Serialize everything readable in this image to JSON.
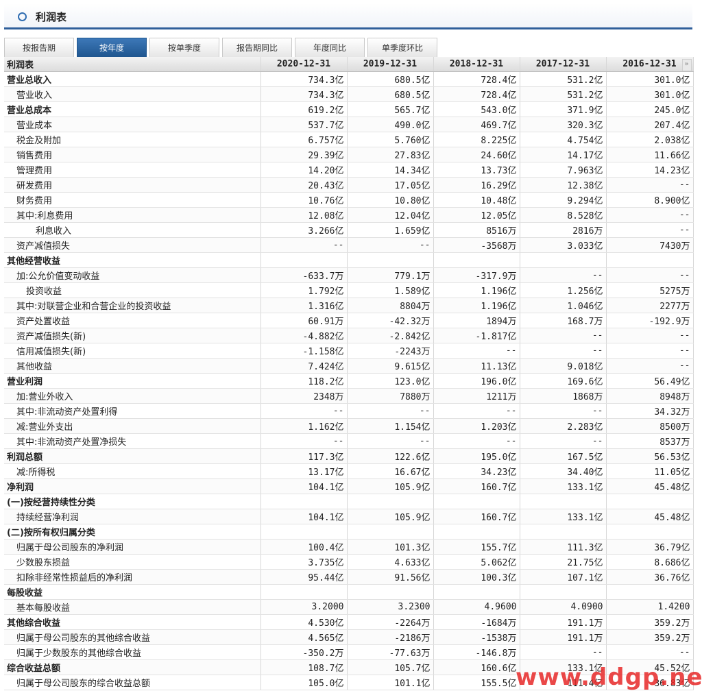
{
  "title": "利润表",
  "tabs": [
    {
      "label": "按报告期",
      "active": false
    },
    {
      "label": "按年度",
      "active": true
    },
    {
      "label": "按单季度",
      "active": false
    },
    {
      "label": "报告期同比",
      "active": false
    },
    {
      "label": "年度同比",
      "active": false
    },
    {
      "label": "单季度环比",
      "active": false
    }
  ],
  "table": {
    "corner": "利润表",
    "columns": [
      "2020-12-31",
      "2019-12-31",
      "2018-12-31",
      "2017-12-31",
      "2016-12-31"
    ],
    "scroll_glyph": "»",
    "rows": [
      {
        "label": "营业总收入",
        "header": true,
        "indent": 0,
        "values": [
          "734.3亿",
          "680.5亿",
          "728.4亿",
          "531.2亿",
          "301.0亿"
        ]
      },
      {
        "label": "营业收入",
        "header": false,
        "indent": 1,
        "values": [
          "734.3亿",
          "680.5亿",
          "728.4亿",
          "531.2亿",
          "301.0亿"
        ]
      },
      {
        "label": "营业总成本",
        "header": true,
        "indent": 0,
        "values": [
          "619.2亿",
          "565.7亿",
          "543.0亿",
          "371.9亿",
          "245.0亿"
        ]
      },
      {
        "label": "营业成本",
        "header": false,
        "indent": 1,
        "values": [
          "537.7亿",
          "490.0亿",
          "469.7亿",
          "320.3亿",
          "207.4亿"
        ]
      },
      {
        "label": "税金及附加",
        "header": false,
        "indent": 1,
        "values": [
          "6.757亿",
          "5.760亿",
          "8.225亿",
          "4.754亿",
          "2.038亿"
        ]
      },
      {
        "label": "销售费用",
        "header": false,
        "indent": 1,
        "values": [
          "29.39亿",
          "27.83亿",
          "24.60亿",
          "14.17亿",
          "11.66亿"
        ]
      },
      {
        "label": "管理费用",
        "header": false,
        "indent": 1,
        "values": [
          "14.20亿",
          "14.34亿",
          "13.73亿",
          "7.963亿",
          "14.23亿"
        ]
      },
      {
        "label": "研发费用",
        "header": false,
        "indent": 1,
        "values": [
          "20.43亿",
          "17.05亿",
          "16.29亿",
          "12.38亿",
          "--"
        ]
      },
      {
        "label": "财务费用",
        "header": false,
        "indent": 1,
        "values": [
          "10.76亿",
          "10.80亿",
          "10.48亿",
          "9.294亿",
          "8.900亿"
        ]
      },
      {
        "label": "其中:利息费用",
        "header": false,
        "indent": 1,
        "values": [
          "12.08亿",
          "12.04亿",
          "12.05亿",
          "8.528亿",
          "--"
        ]
      },
      {
        "label": "利息收入",
        "header": false,
        "indent": 3,
        "values": [
          "3.266亿",
          "1.659亿",
          "8516万",
          "2816万",
          "--"
        ]
      },
      {
        "label": "资产减值损失",
        "header": false,
        "indent": 1,
        "values": [
          "--",
          "--",
          "-3568万",
          "3.033亿",
          "7430万"
        ]
      },
      {
        "label": "其他经营收益",
        "header": true,
        "indent": 0,
        "values": [
          "",
          "",
          "",
          "",
          ""
        ]
      },
      {
        "label": "加:公允价值变动收益",
        "header": false,
        "indent": 1,
        "values": [
          "-633.7万",
          "779.1万",
          "-317.9万",
          "--",
          "--"
        ]
      },
      {
        "label": "投资收益",
        "header": false,
        "indent": 2,
        "values": [
          "1.792亿",
          "1.589亿",
          "1.196亿",
          "1.256亿",
          "5275万"
        ]
      },
      {
        "label": "其中:对联营企业和合营企业的投资收益",
        "header": false,
        "indent": 1,
        "values": [
          "1.316亿",
          "8804万",
          "1.196亿",
          "1.046亿",
          "2277万"
        ]
      },
      {
        "label": "资产处置收益",
        "header": false,
        "indent": 1,
        "values": [
          "60.91万",
          "-42.32万",
          "1894万",
          "168.7万",
          "-192.9万"
        ]
      },
      {
        "label": "资产减值损失(新)",
        "header": false,
        "indent": 1,
        "values": [
          "-4.882亿",
          "-2.842亿",
          "-1.817亿",
          "--",
          "--"
        ]
      },
      {
        "label": "信用减值损失(新)",
        "header": false,
        "indent": 1,
        "values": [
          "-1.158亿",
          "-2243万",
          "--",
          "--",
          "--"
        ]
      },
      {
        "label": "其他收益",
        "header": false,
        "indent": 1,
        "values": [
          "7.424亿",
          "9.615亿",
          "11.13亿",
          "9.018亿",
          "--"
        ]
      },
      {
        "label": "营业利润",
        "header": true,
        "indent": 0,
        "values": [
          "118.2亿",
          "123.0亿",
          "196.0亿",
          "169.6亿",
          "56.49亿"
        ]
      },
      {
        "label": "加:营业外收入",
        "header": false,
        "indent": 1,
        "values": [
          "2348万",
          "7880万",
          "1211万",
          "1868万",
          "8948万"
        ]
      },
      {
        "label": "其中:非流动资产处置利得",
        "header": false,
        "indent": 1,
        "values": [
          "--",
          "--",
          "--",
          "--",
          "34.32万"
        ]
      },
      {
        "label": "减:营业外支出",
        "header": false,
        "indent": 1,
        "values": [
          "1.162亿",
          "1.154亿",
          "1.203亿",
          "2.283亿",
          "8500万"
        ]
      },
      {
        "label": "其中:非流动资产处置净损失",
        "header": false,
        "indent": 1,
        "values": [
          "--",
          "--",
          "--",
          "--",
          "8537万"
        ]
      },
      {
        "label": "利润总额",
        "header": true,
        "indent": 0,
        "values": [
          "117.3亿",
          "122.6亿",
          "195.0亿",
          "167.5亿",
          "56.53亿"
        ]
      },
      {
        "label": "减:所得税",
        "header": false,
        "indent": 1,
        "values": [
          "13.17亿",
          "16.67亿",
          "34.23亿",
          "34.40亿",
          "11.05亿"
        ]
      },
      {
        "label": "净利润",
        "header": true,
        "indent": 0,
        "values": [
          "104.1亿",
          "105.9亿",
          "160.7亿",
          "133.1亿",
          "45.48亿"
        ]
      },
      {
        "label": "(一)按经营持续性分类",
        "header": true,
        "indent": 0,
        "values": [
          "",
          "",
          "",
          "",
          ""
        ]
      },
      {
        "label": "持续经营净利润",
        "header": false,
        "indent": 1,
        "values": [
          "104.1亿",
          "105.9亿",
          "160.7亿",
          "133.1亿",
          "45.48亿"
        ]
      },
      {
        "label": "(二)按所有权归属分类",
        "header": true,
        "indent": 0,
        "values": [
          "",
          "",
          "",
          "",
          ""
        ]
      },
      {
        "label": "归属于母公司股东的净利润",
        "header": false,
        "indent": 1,
        "values": [
          "100.4亿",
          "101.3亿",
          "155.7亿",
          "111.3亿",
          "36.79亿"
        ]
      },
      {
        "label": "少数股东损益",
        "header": false,
        "indent": 1,
        "values": [
          "3.735亿",
          "4.633亿",
          "5.062亿",
          "21.75亿",
          "8.686亿"
        ]
      },
      {
        "label": "扣除非经常性损益后的净利润",
        "header": false,
        "indent": 1,
        "values": [
          "95.44亿",
          "91.56亿",
          "100.3亿",
          "107.1亿",
          "36.76亿"
        ]
      },
      {
        "label": "每股收益",
        "header": true,
        "indent": 0,
        "values": [
          "",
          "",
          "",
          "",
          ""
        ]
      },
      {
        "label": "基本每股收益",
        "header": false,
        "indent": 1,
        "values": [
          "3.2000",
          "3.2300",
          "4.9600",
          "4.0900",
          "1.4200"
        ]
      },
      {
        "label": "其他综合收益",
        "header": true,
        "indent": 0,
        "values": [
          "4.530亿",
          "-2264万",
          "-1684万",
          "191.1万",
          "359.2万"
        ]
      },
      {
        "label": "归属于母公司股东的其他综合收益",
        "header": false,
        "indent": 1,
        "values": [
          "4.565亿",
          "-2186万",
          "-1538万",
          "191.1万",
          "359.2万"
        ]
      },
      {
        "label": "归属于少数股东的其他综合收益",
        "header": false,
        "indent": 1,
        "values": [
          "-350.2万",
          "-77.63万",
          "-146.8万",
          "--",
          "--"
        ]
      },
      {
        "label": "综合收益总额",
        "header": true,
        "indent": 0,
        "values": [
          "108.7亿",
          "105.7亿",
          "160.6亿",
          "133.1亿",
          "45.52亿"
        ]
      },
      {
        "label": "归属于母公司股东的综合收益总额",
        "header": false,
        "indent": 1,
        "values": [
          "105.0亿",
          "101.1亿",
          "155.5亿",
          "111.4亿",
          "36.83亿"
        ]
      }
    ]
  },
  "watermark": "www.ddgp.net"
}
